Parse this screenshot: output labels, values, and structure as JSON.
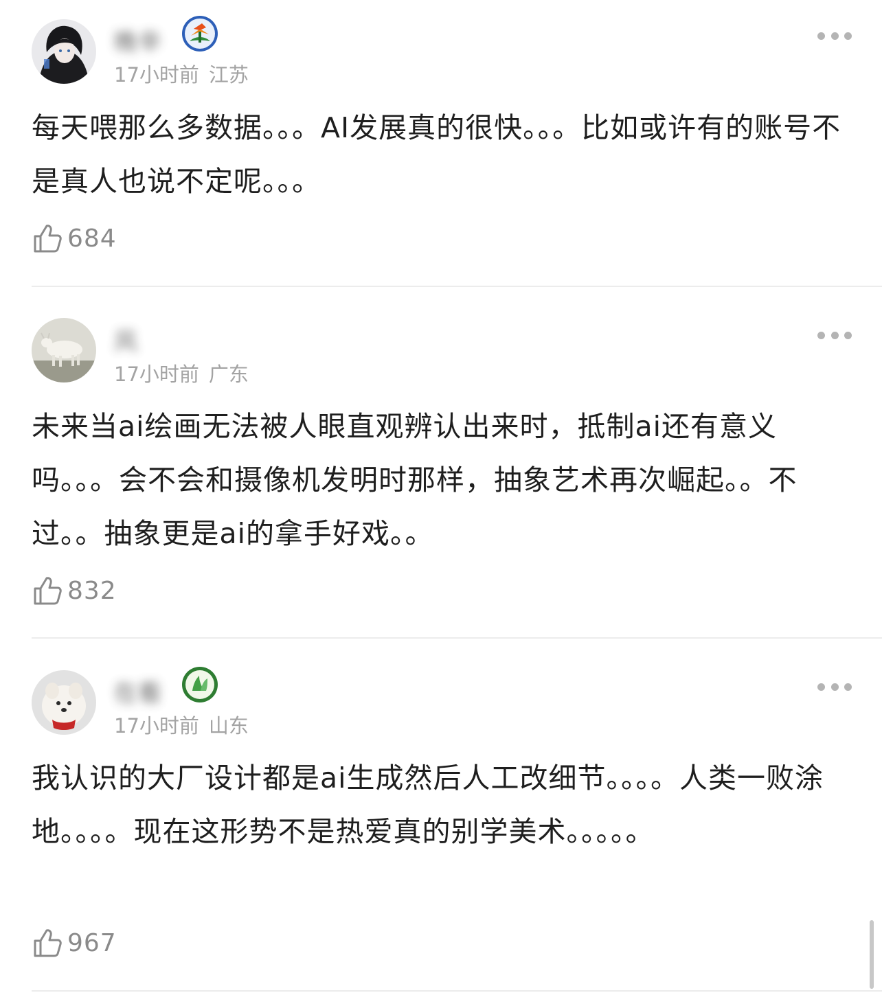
{
  "comments": [
    {
      "username": "晚辛",
      "time": "17小时前",
      "location": "江苏",
      "text": "每天喂那么多数据。。。AI发展真的很快。。。比如或许有的账号不是真人也说不定呢。。。",
      "likes": "684"
    },
    {
      "username": "风",
      "time": "17小时前",
      "location": "广东",
      "text": "未来当ai绘画无法被人眼直观辨认出来时，抵制ai还有意义吗。。。会不会和摄像机发明时那样，抽象艺术再次崛起。。不过。。抽象更是ai的拿手好戏。。",
      "likes": "832"
    },
    {
      "username": "在看",
      "time": "17小时前",
      "location": "山东",
      "text": "我认识的大厂设计都是ai生成然后人工改细节。。。。人类一败涂地。。。。现在这形势不是热爱真的别学美术。。。。。",
      "likes": "967"
    }
  ],
  "icons": {
    "more": "more-dots-icon",
    "like": "thumbs-up-icon"
  },
  "colors": {
    "meta": "#a3a3a3",
    "like_count": "#8a8a8a",
    "divider": "#ececec"
  }
}
